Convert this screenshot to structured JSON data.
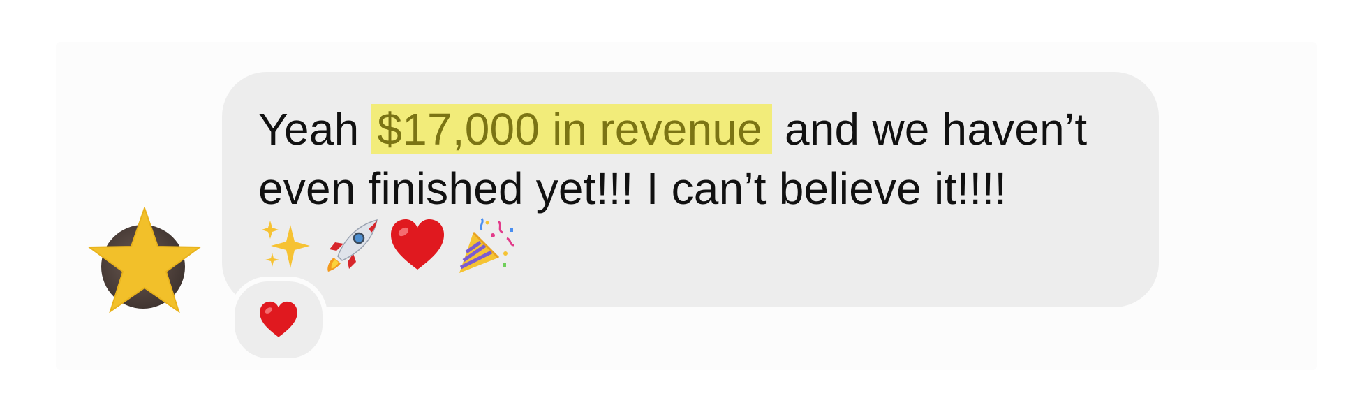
{
  "message": {
    "text_before": "Yeah ",
    "highlight": "$17,000 in revenue",
    "text_after": " and we haven’t",
    "line2": "even finished yet!!! I can’t believe it!!!!",
    "emojis": [
      "sparkles-icon",
      "rocket-icon",
      "red-heart-icon",
      "party-popper-icon"
    ]
  },
  "reaction": {
    "emoji": "red-heart-icon"
  },
  "avatar": {
    "overlay_icon": "star-icon"
  },
  "colors": {
    "bubble": "#ededed",
    "highlight_bg": "#f2ec7a",
    "highlight_text": "#7b7414",
    "text": "#111111",
    "star": "#f2c02a",
    "heart": "#e0191f"
  }
}
